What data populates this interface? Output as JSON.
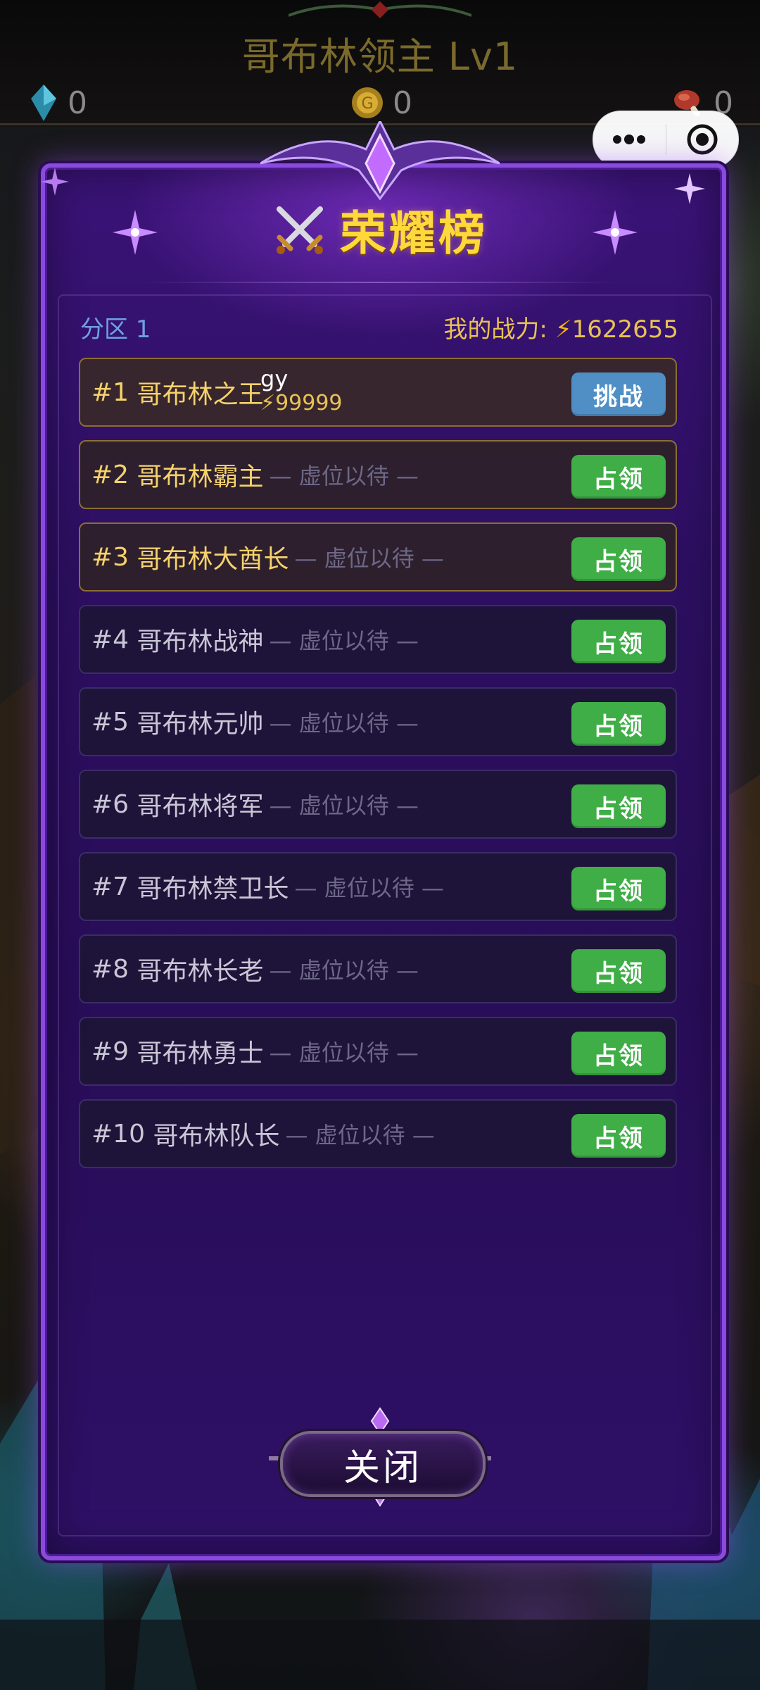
{
  "hud": {
    "title": "哥布林领主 Lv1",
    "resources": [
      {
        "icon": "crystal-icon",
        "value": "0"
      },
      {
        "icon": "gold-coin-icon",
        "value": "0"
      },
      {
        "icon": "meat-icon",
        "value": "0"
      }
    ]
  },
  "capsule": {
    "more_icon": "more-dots-icon",
    "close_icon": "target-close-icon"
  },
  "dialog": {
    "title": "荣耀榜",
    "title_icon": "crossed-swords-icon",
    "zone_label": "分区 1",
    "my_power_label": "我的战力: ",
    "my_power_value": "1622655",
    "power_icon": "lightning-icon",
    "close_label": "关闭"
  },
  "ranks": [
    {
      "rank": "#1",
      "title": "哥布林之王",
      "holder_name": "gy",
      "holder_power": "99999",
      "vacant": "",
      "action": "挑战"
    },
    {
      "rank": "#2",
      "title": "哥布林霸主",
      "holder_name": "",
      "holder_power": "",
      "vacant": "— 虚位以待 —",
      "action": "占领"
    },
    {
      "rank": "#3",
      "title": "哥布林大酋长",
      "holder_name": "",
      "holder_power": "",
      "vacant": "— 虚位以待 —",
      "action": "占领"
    },
    {
      "rank": "#4",
      "title": "哥布林战神",
      "holder_name": "",
      "holder_power": "",
      "vacant": "— 虚位以待 —",
      "action": "占领"
    },
    {
      "rank": "#5",
      "title": "哥布林元帅",
      "holder_name": "",
      "holder_power": "",
      "vacant": "— 虚位以待 —",
      "action": "占领"
    },
    {
      "rank": "#6",
      "title": "哥布林将军",
      "holder_name": "",
      "holder_power": "",
      "vacant": "— 虚位以待 —",
      "action": "占领"
    },
    {
      "rank": "#7",
      "title": "哥布林禁卫长",
      "holder_name": "",
      "holder_power": "",
      "vacant": "— 虚位以待 —",
      "action": "占领"
    },
    {
      "rank": "#8",
      "title": "哥布林长老",
      "holder_name": "",
      "holder_power": "",
      "vacant": "— 虚位以待 —",
      "action": "占领"
    },
    {
      "rank": "#9",
      "title": "哥布林勇士",
      "holder_name": "",
      "holder_power": "",
      "vacant": "— 虚位以待 —",
      "action": "占领"
    },
    {
      "rank": "#10",
      "title": "哥布林队长",
      "holder_name": "",
      "holder_power": "",
      "vacant": "— 虚位以待 —",
      "action": "占领"
    }
  ],
  "colors": {
    "title_gold": "#ffd83a",
    "occupy_green": "#3fae46",
    "challenge_blue": "#4f8fc6",
    "panel_purple": "#2c0f60",
    "zone_blue": "#6fa0e0"
  }
}
